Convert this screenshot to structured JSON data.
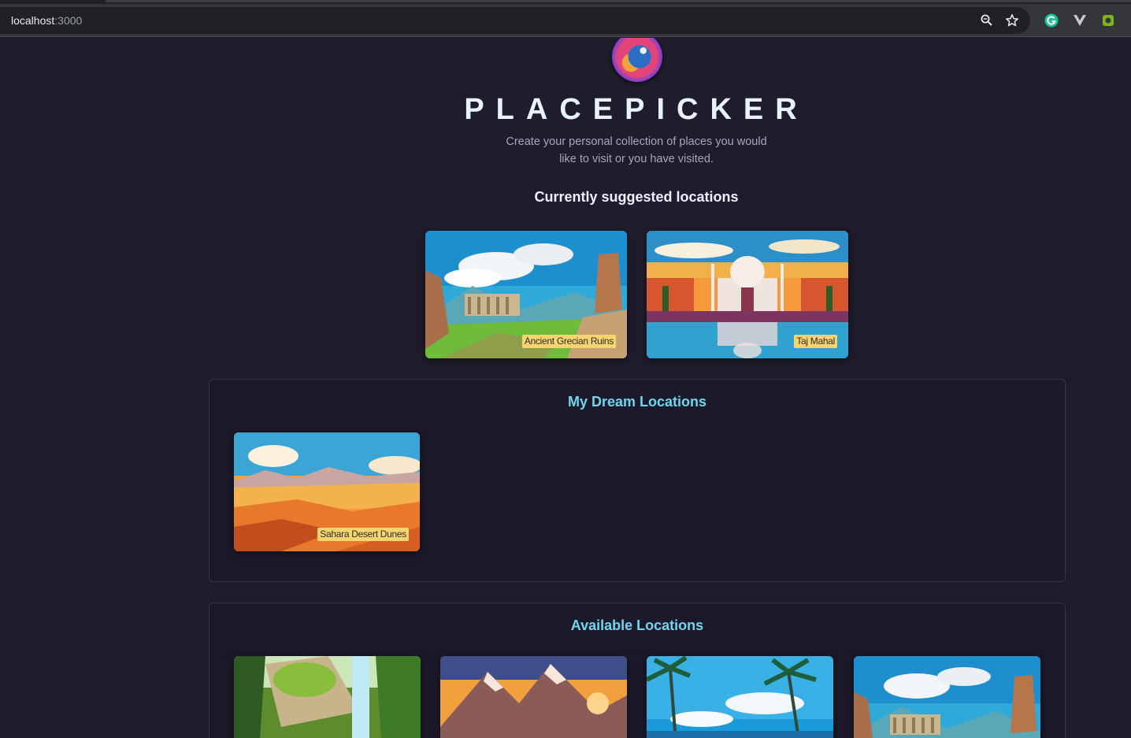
{
  "browser": {
    "url_host": "localhost",
    "url_port": ":3000",
    "icons": [
      "zoom-icon",
      "bookmark-star-icon",
      "grammarly-icon",
      "vue-devtools-icon",
      "extension-icon"
    ]
  },
  "header": {
    "logo": "globe-logo",
    "title": "PLACEPICKER",
    "subtitle": "Create your personal collection of places you would like to visit or you have visited."
  },
  "suggested": {
    "heading": "Currently suggested locations",
    "places": [
      {
        "title": "Ancient Grecian Ruins",
        "image": "ruins"
      },
      {
        "title": "Taj Mahal",
        "image": "taj"
      }
    ]
  },
  "dream": {
    "heading": "My Dream Locations",
    "places": [
      {
        "title": "Sahara Desert Dunes",
        "image": "desert"
      }
    ]
  },
  "available": {
    "heading": "Available Locations",
    "places": [
      {
        "image": "forest-waterfall"
      },
      {
        "image": "mountains"
      },
      {
        "image": "beach"
      },
      {
        "image": "ruins"
      }
    ]
  },
  "colors": {
    "page_bg": "#1f1c2c",
    "accent": "#6fd6f0",
    "label_bg": "#f7d56e"
  }
}
